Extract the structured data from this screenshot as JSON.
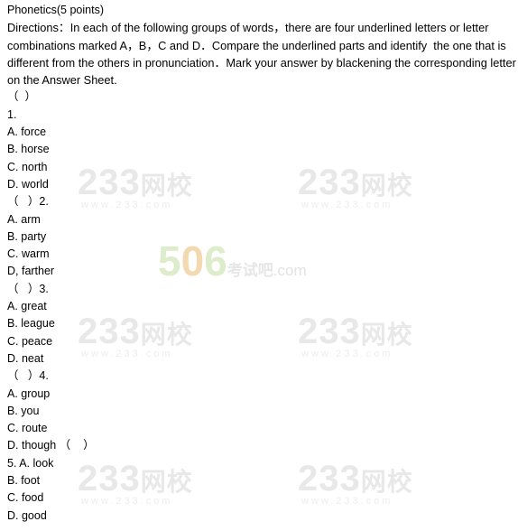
{
  "document": {
    "title": "Phonetics(5 points)",
    "directions": "Directions：In each of the following groups of words，there are four underlined letters or letter combinations marked A，B，C and D．Compare the underlined parts and identify  the one that is different from the others in pronunciation．Mark your answer by blackening the corresponding letter on the Answer Sheet.",
    "lines": [
      "（  ）",
      "1.",
      "A. force",
      "B. horse",
      "C. north",
      "D. world",
      "（   ）2.",
      "A. arm",
      "B. party",
      "C. warm",
      "D, farther",
      "（   ）3.",
      "A. great",
      "B. league",
      "C. peace",
      "D. neat",
      "（   ）4.",
      "A. group",
      "B. you",
      "C. route",
      "D. though （    ）",
      "5. A. look",
      "B. foot",
      "C. food",
      "D. good"
    ]
  },
  "watermarks": {
    "brand_233": "233",
    "brand_233_suffix": "网校",
    "brand_233_url": "www.233.com",
    "brand_506_5": "5",
    "brand_506_0": "0",
    "brand_506_6": "6",
    "brand_506_cn": "考试吧",
    "brand_506_com": ".com"
  }
}
